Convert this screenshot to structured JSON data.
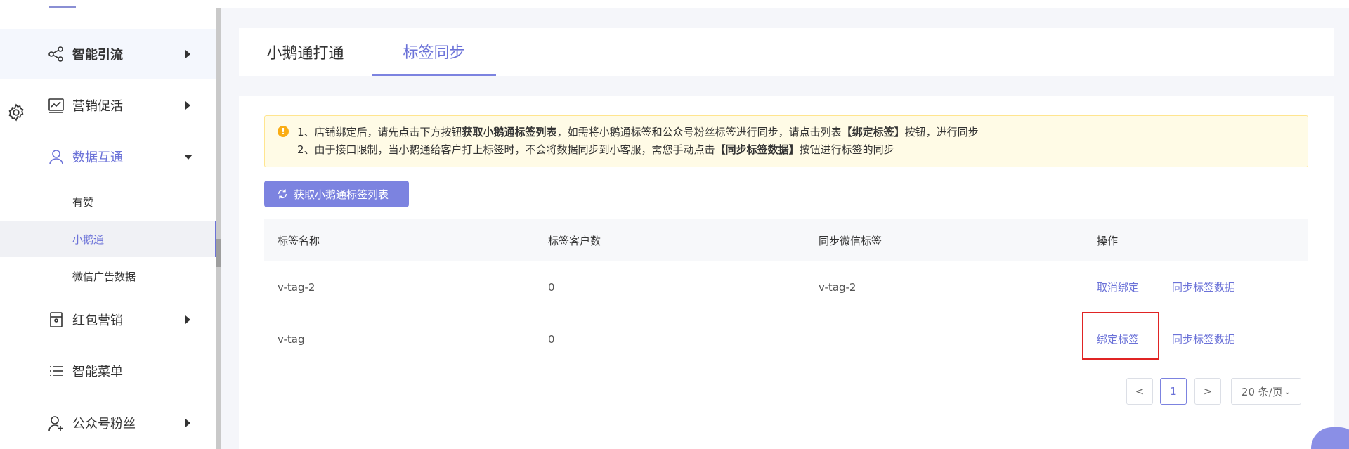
{
  "sidebar": {
    "items": [
      {
        "label": "智能引流",
        "icon": "share-icon"
      },
      {
        "label": "营销促活",
        "icon": "chart-icon"
      },
      {
        "label": "数据互通",
        "icon": "user-icon"
      },
      {
        "label": "红包营销",
        "icon": "gift-box-icon"
      },
      {
        "label": "智能菜单",
        "icon": "list-icon"
      },
      {
        "label": "公众号粉丝",
        "icon": "user-plus-icon"
      }
    ],
    "sub_items": [
      {
        "label": "有赞"
      },
      {
        "label": "小鹅通"
      },
      {
        "label": "微信广告数据"
      }
    ]
  },
  "tabs": [
    {
      "label": "小鹅通打通"
    },
    {
      "label": "标签同步"
    }
  ],
  "notice": {
    "line1_a": "1、店铺绑定后，请先点击下方按钮",
    "line1_b": "获取小鹅通标签列表",
    "line1_c": "，如需将小鹅通标签和公众号粉丝标签进行同步，请点击列表",
    "line1_d": "【绑定标签】",
    "line1_e": "按钮，进行同步",
    "line2_a": "2、由于接口限制，当小鹅通给客户打上标签时，不会将数据同步到小客服，需您手动点击",
    "line2_b": "【同步标签数据】",
    "line2_c": "按钮进行标签的同步"
  },
  "fetch_button": {
    "label": "获取小鹅通标签列表"
  },
  "table": {
    "headers": [
      "标签名称",
      "标签客户数",
      "同步微信标签",
      "操作"
    ],
    "rows": [
      {
        "name": "v-tag-2",
        "count": "0",
        "wechat_tag": "v-tag-2",
        "action1": "取消绑定",
        "action2": "同步标签数据"
      },
      {
        "name": "v-tag",
        "count": "0",
        "wechat_tag": "",
        "action1": "绑定标签",
        "action2": "同步标签数据"
      }
    ]
  },
  "pagination": {
    "prev": "<",
    "current": "1",
    "next": ">",
    "page_size": "20 条/页"
  },
  "colors": {
    "accent": "#7c83e0",
    "highlight": "#e02424",
    "notice_bg": "#fffbe6"
  }
}
